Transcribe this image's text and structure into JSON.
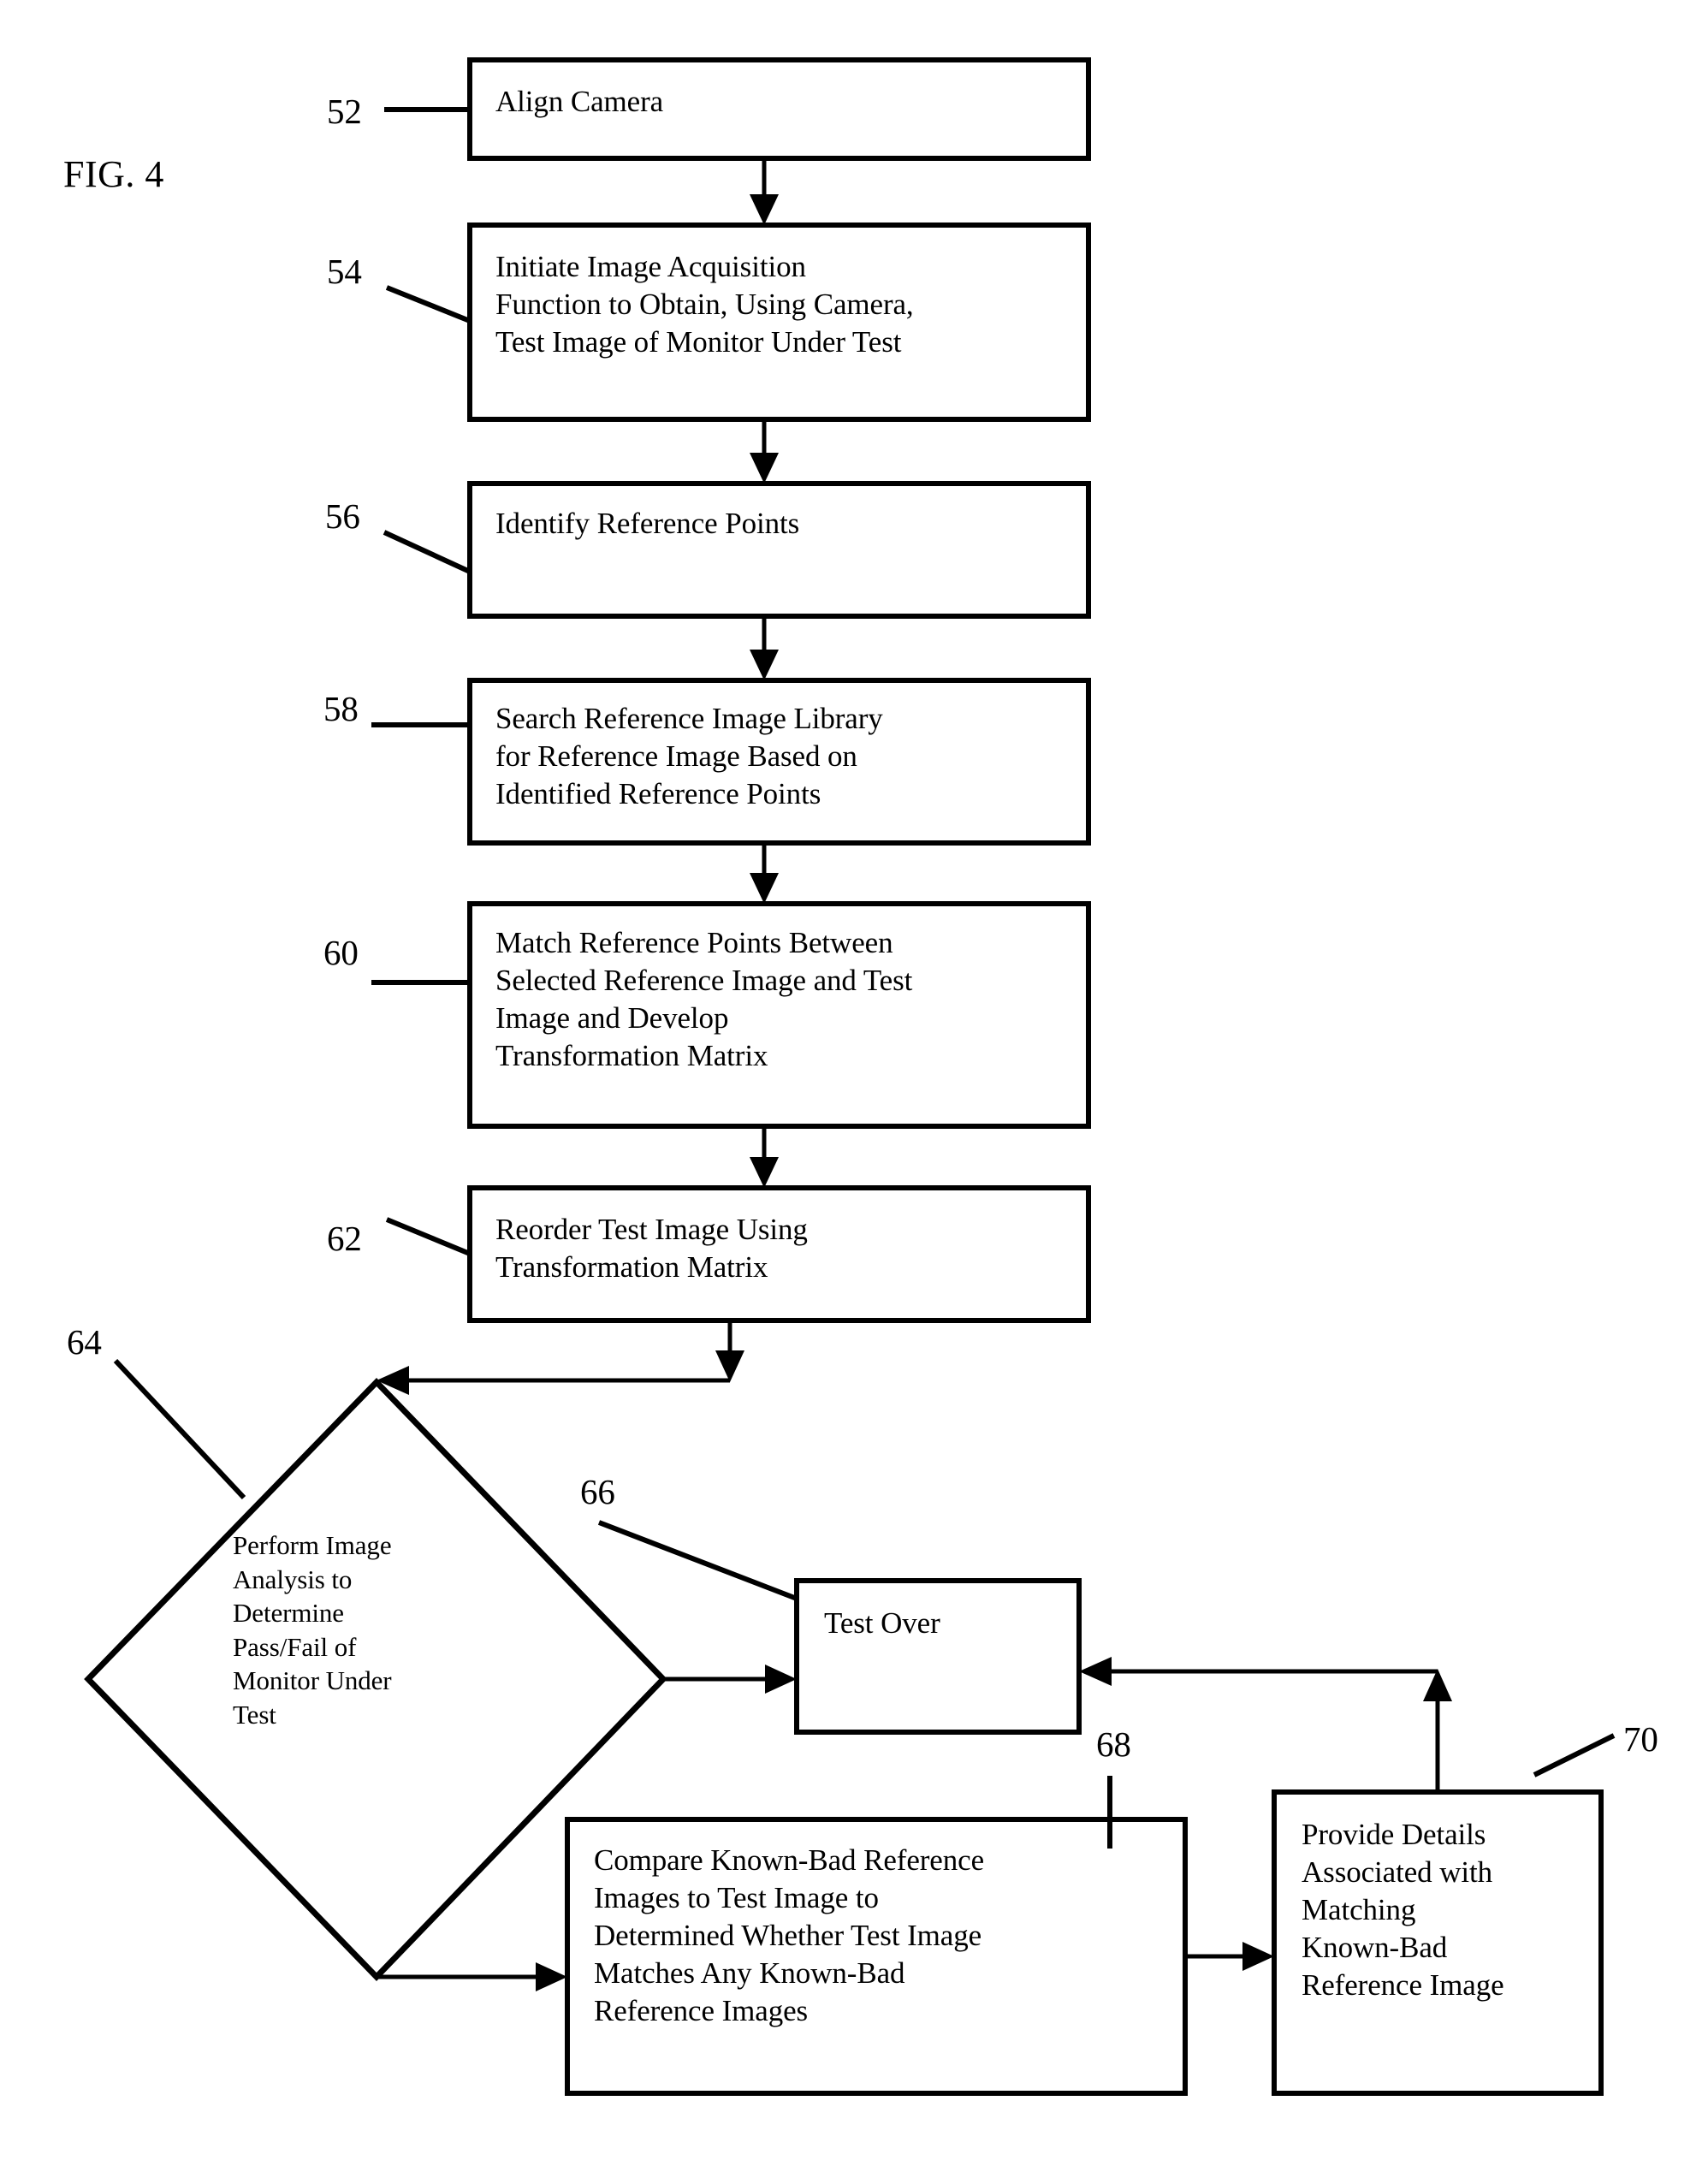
{
  "figure": {
    "label": "FIG. 4"
  },
  "nodes": [
    {
      "id": "n52",
      "ref": "52",
      "shape": "rect",
      "text": "Align Camera"
    },
    {
      "id": "n54",
      "ref": "54",
      "shape": "rect",
      "text": "Initiate Image Acquisition\nFunction to Obtain, Using Camera,\nTest Image of Monitor Under Test"
    },
    {
      "id": "n56",
      "ref": "56",
      "shape": "rect",
      "text": "Identify Reference Points"
    },
    {
      "id": "n58",
      "ref": "58",
      "shape": "rect",
      "text": "Search Reference Image Library\nfor Reference Image Based on\nIdentified Reference Points"
    },
    {
      "id": "n60",
      "ref": "60",
      "shape": "rect",
      "text": "Match Reference Points Between\nSelected Reference Image and Test\nImage and Develop\nTransformation Matrix"
    },
    {
      "id": "n62",
      "ref": "62",
      "shape": "rect",
      "text": "Reorder Test Image Using\nTransformation Matrix"
    },
    {
      "id": "n64",
      "ref": "64",
      "shape": "diamond",
      "text": "Perform Image\nAnalysis to\nDetermine\nPass/Fail of\nMonitor Under\nTest"
    },
    {
      "id": "n66",
      "ref": "66",
      "shape": "rect",
      "text": "Test Over"
    },
    {
      "id": "n68",
      "ref": "68",
      "shape": "rect",
      "text": "Compare Known-Bad Reference\nImages to Test Image to\nDetermined Whether Test Image\nMatches Any Known-Bad\nReference Images"
    },
    {
      "id": "n70",
      "ref": "70",
      "shape": "rect",
      "text": "Provide Details\nAssociated with\nMatching\nKnown-Bad\nReference Image"
    }
  ],
  "colors": {
    "stroke": "#000000",
    "fill": "#ffffff",
    "background": "#ffffff"
  }
}
